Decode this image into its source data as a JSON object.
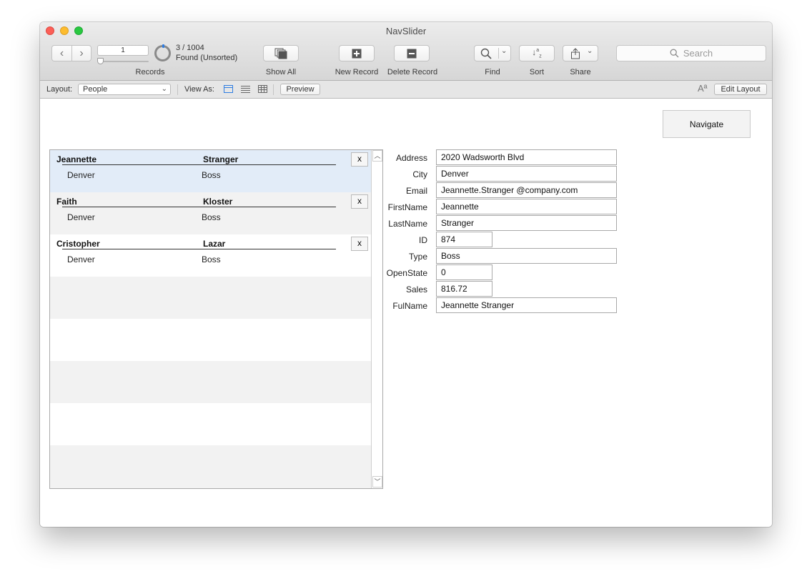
{
  "window": {
    "title": "NavSlider"
  },
  "toolbar": {
    "record_number": "1",
    "record_count": "3 / 1004",
    "found_state": "Found (Unsorted)",
    "records_label": "Records",
    "show_all_label": "Show All",
    "new_record_label": "New Record",
    "delete_record_label": "Delete Record",
    "find_label": "Find",
    "sort_label": "Sort",
    "share_label": "Share",
    "search_placeholder": "Search"
  },
  "layoutbar": {
    "layout_label": "Layout:",
    "layout_value": "People",
    "view_as_label": "View As:",
    "preview_label": "Preview",
    "font_glyph": "Aª",
    "edit_layout_label": "Edit Layout"
  },
  "content": {
    "navigate_label": "Navigate",
    "delete_row_label": "x",
    "portal_rows": [
      {
        "first": "Jeannette",
        "last": "Stranger",
        "city": "Denver",
        "type": "Boss"
      },
      {
        "first": "Faith",
        "last": "Kloster",
        "city": "Denver",
        "type": "Boss"
      },
      {
        "first": "Cristopher",
        "last": "Lazar",
        "city": "Denver",
        "type": "Boss"
      }
    ],
    "fields": [
      {
        "label": "Address",
        "value": "2020 Wadsworth Blvd"
      },
      {
        "label": "City",
        "value": "Denver"
      },
      {
        "label": "Email",
        "value": "Jeannette.Stranger @company.com"
      },
      {
        "label": "FirstName",
        "value": "Jeannette"
      },
      {
        "label": "LastName",
        "value": "Stranger"
      },
      {
        "label": "ID",
        "value": "874"
      },
      {
        "label": "Type",
        "value": "Boss"
      },
      {
        "label": "OpenState",
        "value": "0"
      },
      {
        "label": "Sales",
        "value": "816.72"
      },
      {
        "label": "FulName",
        "value": "Jeannette Stranger"
      }
    ]
  },
  "colors": {
    "accent": "#2f7de1",
    "selected_row": "#e2ecf8"
  }
}
